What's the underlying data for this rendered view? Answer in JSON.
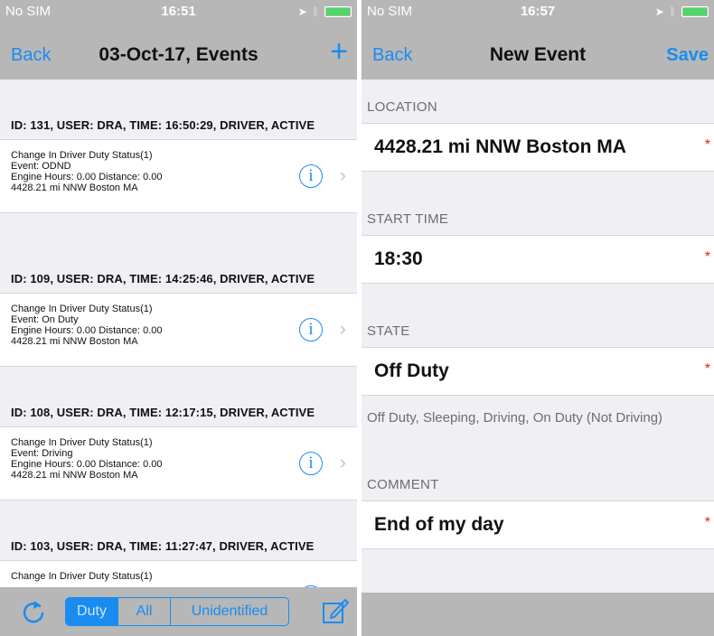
{
  "left": {
    "status": {
      "carrier": "No SIM",
      "time": "16:51"
    },
    "nav": {
      "back": "Back",
      "title": "03-Oct-17, Events",
      "add": "+"
    },
    "events": [
      {
        "header": "ID: 131, USER: DRA, TIME: 16:50:29, DRIVER, ACTIVE",
        "lines": [
          "Change In Driver Duty Status(1)",
          "Event: ODND",
          "Engine Hours: 0.00 Distance: 0.00",
          "4428.21 mi NNW Boston MA"
        ]
      },
      {
        "header": "ID: 109, USER: DRA, TIME: 14:25:46, DRIVER, ACTIVE",
        "lines": [
          "Change In Driver Duty Status(1)",
          "Event: On Duty",
          "Engine Hours: 0.00 Distance: 0.00",
          "4428.21 mi NNW Boston MA"
        ]
      },
      {
        "header": "ID: 108, USER: DRA, TIME: 12:17:15, DRIVER, ACTIVE",
        "lines": [
          "Change In Driver Duty Status(1)",
          "Event: Driving",
          "Engine Hours: 0.00 Distance: 0.00",
          "4428.21 mi NNW Boston MA"
        ]
      },
      {
        "header": "ID: 103, USER: DRA, TIME: 11:27:47, DRIVER, ACTIVE",
        "lines": [
          "Change In Driver Duty Status(1)",
          "",
          "",
          ""
        ]
      }
    ],
    "toolbar": {
      "segments": [
        "Duty",
        "All",
        "Unidentified"
      ],
      "selected": "Duty"
    }
  },
  "right": {
    "status": {
      "carrier": "No SIM",
      "time": "16:57"
    },
    "nav": {
      "back": "Back",
      "title": "New Event",
      "save": "Save"
    },
    "location_label": "LOCATION",
    "location_value": "4428.21 mi NNW Boston MA",
    "start_label": "START TIME",
    "start_value": "18:30",
    "state_label": "STATE",
    "state_value": "Off Duty",
    "state_hint": "Off Duty, Sleeping, Driving, On Duty (Not Driving)",
    "comment_label": "COMMENT",
    "comment_value": "End of my day",
    "required_mark": "*"
  },
  "colors": {
    "accent": "#1a8cf0",
    "bar": "#b7b7b7",
    "background": "#efeff4",
    "required": "#e0202a"
  }
}
